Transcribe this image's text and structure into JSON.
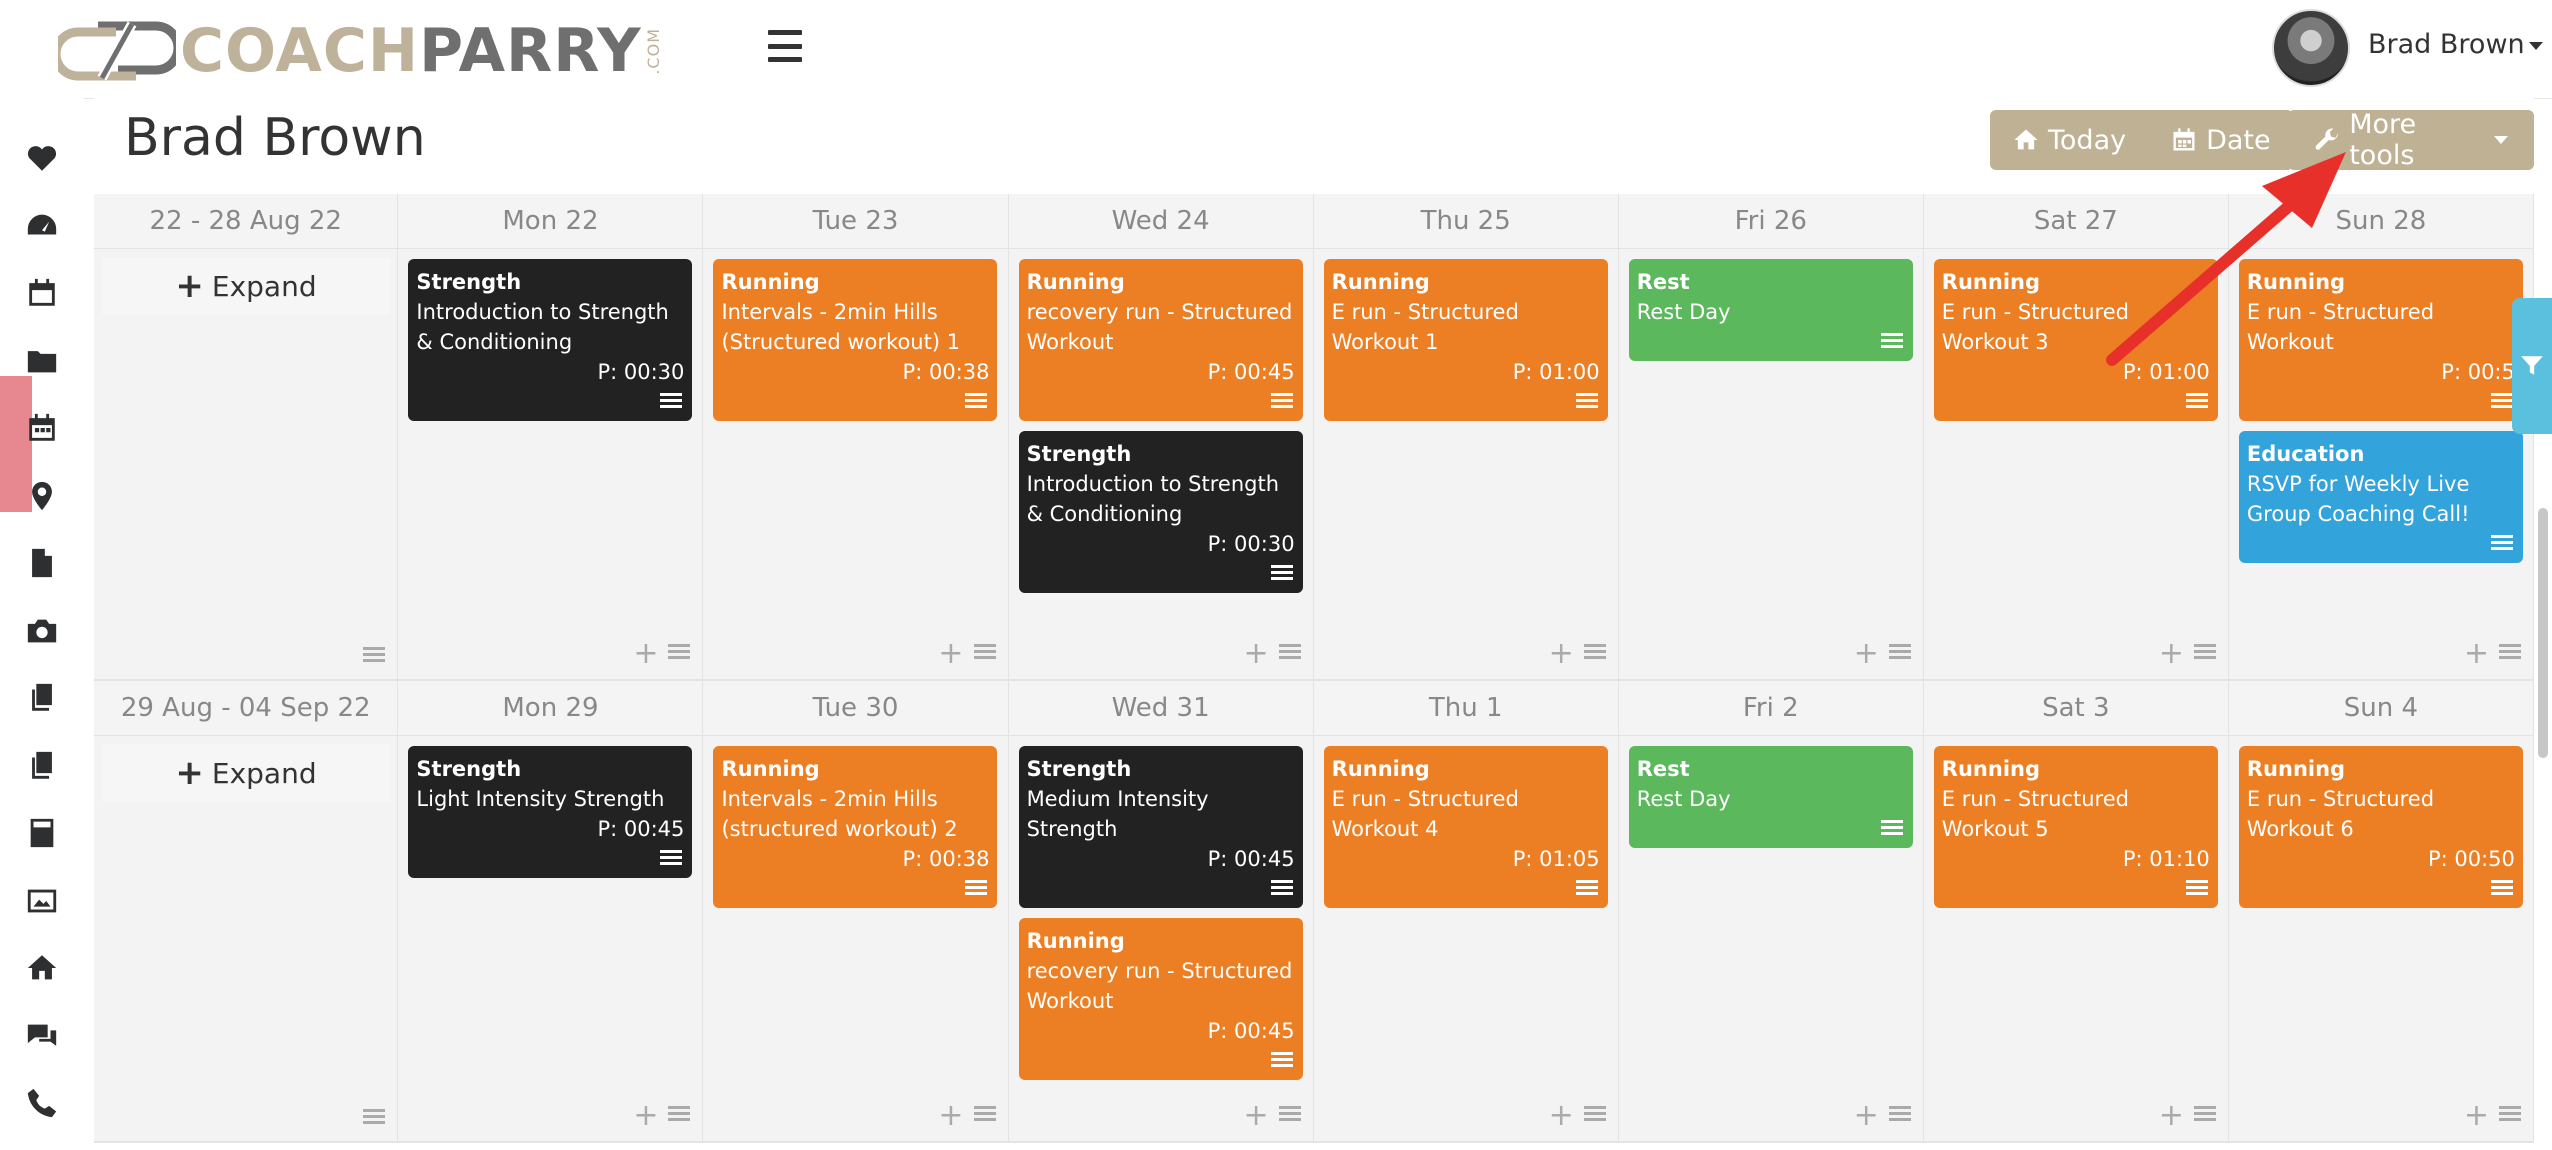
{
  "brand": {
    "part1": "COACH",
    "part2": "PARRY",
    "suffix": ".COM"
  },
  "user": {
    "name": "Brad Brown"
  },
  "page": {
    "title": "Brad Brown"
  },
  "toolbar": {
    "today": "Today",
    "date": "Date",
    "more_tools": "More tools"
  },
  "sidebar": {
    "icons": [
      "heartbeat-icon",
      "dashboard-icon",
      "calendar-icon",
      "folder-icon",
      "calendar-alt-icon",
      "map-marker-icon",
      "file-icon",
      "camera-icon",
      "copy-icon",
      "copy-alt-icon",
      "calculator-icon",
      "image-icon",
      "home-icon",
      "comments-icon",
      "phone-icon"
    ]
  },
  "colors": {
    "strength": "#222222",
    "running": "#ec7f24",
    "rest": "#5cb85c",
    "education": "#33a3db",
    "accent": "#beb194",
    "filter": "#5bc0de"
  },
  "weeks": [
    {
      "range": "22 - 28 Aug 22",
      "expand": "Expand",
      "days": [
        {
          "label": "Mon 22",
          "cards": [
            {
              "kind": "strength",
              "type": "Strength",
              "desc": "Introduction to Strength & Conditioning",
              "plan": "P: 00:30"
            }
          ]
        },
        {
          "label": "Tue 23",
          "cards": [
            {
              "kind": "running",
              "type": "Running",
              "desc": "Intervals - 2min Hills (Structured workout) 1",
              "plan": "P: 00:38"
            }
          ]
        },
        {
          "label": "Wed 24",
          "cards": [
            {
              "kind": "running",
              "type": "Running",
              "desc": "recovery run - Structured Workout",
              "plan": "P: 00:45"
            },
            {
              "kind": "strength",
              "type": "Strength",
              "desc": "Introduction to Strength & Conditioning",
              "plan": "P: 00:30"
            }
          ]
        },
        {
          "label": "Thu 25",
          "cards": [
            {
              "kind": "running",
              "type": "Running",
              "desc": "E run - Structured Workout 1",
              "plan": "P: 01:00"
            }
          ]
        },
        {
          "label": "Fri 26",
          "cards": [
            {
              "kind": "rest",
              "type": "Rest",
              "desc": "Rest Day",
              "plan": ""
            }
          ]
        },
        {
          "label": "Sat 27",
          "cards": [
            {
              "kind": "running",
              "type": "Running",
              "desc": "E run - Structured Workout 3",
              "plan": "P: 01:00"
            }
          ]
        },
        {
          "label": "Sun 28",
          "cards": [
            {
              "kind": "running",
              "type": "Running",
              "desc": "E run - Structured Workout",
              "plan": "P: 00:5"
            },
            {
              "kind": "education",
              "type": "Education",
              "desc": "RSVP for Weekly Live Group Coaching Call!",
              "plan": ""
            }
          ]
        }
      ]
    },
    {
      "range": "29 Aug - 04 Sep 22",
      "expand": "Expand",
      "days": [
        {
          "label": "Mon 29",
          "cards": [
            {
              "kind": "strength",
              "type": "Strength",
              "desc": "Light Intensity Strength",
              "plan": "P: 00:45"
            }
          ]
        },
        {
          "label": "Tue 30",
          "cards": [
            {
              "kind": "running",
              "type": "Running",
              "desc": "Intervals - 2min Hills (structured workout) 2",
              "plan": "P: 00:38"
            }
          ]
        },
        {
          "label": "Wed 31",
          "cards": [
            {
              "kind": "strength",
              "type": "Strength",
              "desc": "Medium Intensity Strength",
              "plan": "P: 00:45"
            },
            {
              "kind": "running",
              "type": "Running",
              "desc": "recovery run - Structured Workout",
              "plan": "P: 00:45"
            }
          ]
        },
        {
          "label": "Thu 1",
          "cards": [
            {
              "kind": "running",
              "type": "Running",
              "desc": "E run - Structured Workout 4",
              "plan": "P: 01:05"
            }
          ]
        },
        {
          "label": "Fri 2",
          "cards": [
            {
              "kind": "rest",
              "type": "Rest",
              "desc": "Rest Day",
              "plan": ""
            }
          ]
        },
        {
          "label": "Sat 3",
          "cards": [
            {
              "kind": "running",
              "type": "Running",
              "desc": "E run - Structured Workout 5",
              "plan": "P: 01:10"
            }
          ]
        },
        {
          "label": "Sun 4",
          "cards": [
            {
              "kind": "running",
              "type": "Running",
              "desc": "E run - Structured Workout 6",
              "plan": "P: 00:50"
            }
          ]
        }
      ]
    }
  ]
}
